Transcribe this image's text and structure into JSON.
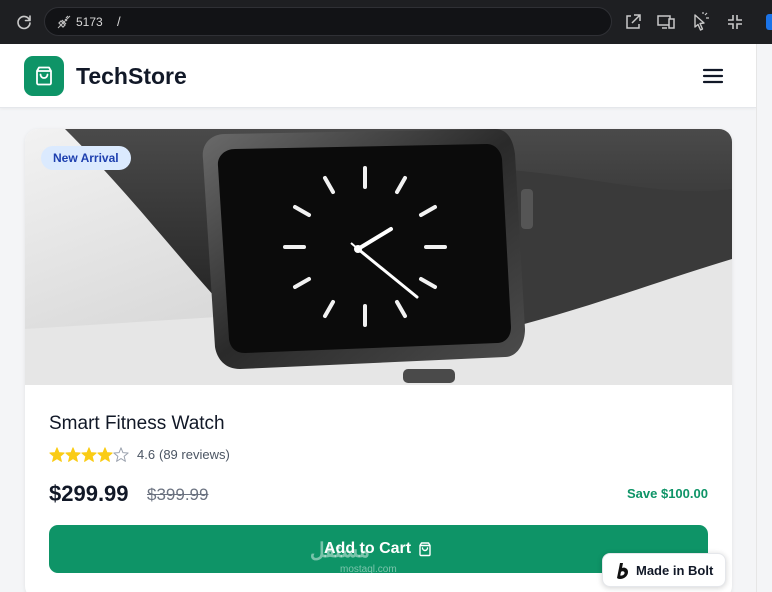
{
  "browser": {
    "port": "5173",
    "path": "/"
  },
  "header": {
    "brand": "TechStore"
  },
  "product": {
    "badge": "New Arrival",
    "title": "Smart Fitness Watch",
    "rating_value": "4.6",
    "rating_count": "(89 reviews)",
    "rating_stars": 4.6,
    "price": "$299.99",
    "old_price": "$399.99",
    "savings": "Save $100.00",
    "cart_label": "Add to Cart"
  },
  "watermark": {
    "text": "مستقل",
    "sub": "mostaql.com"
  },
  "bolt": {
    "label": "Made in Bolt"
  },
  "colors": {
    "accent": "#0e9467",
    "star": "#facc15",
    "badge_bg": "#dbeafe",
    "badge_text": "#1e40af"
  }
}
